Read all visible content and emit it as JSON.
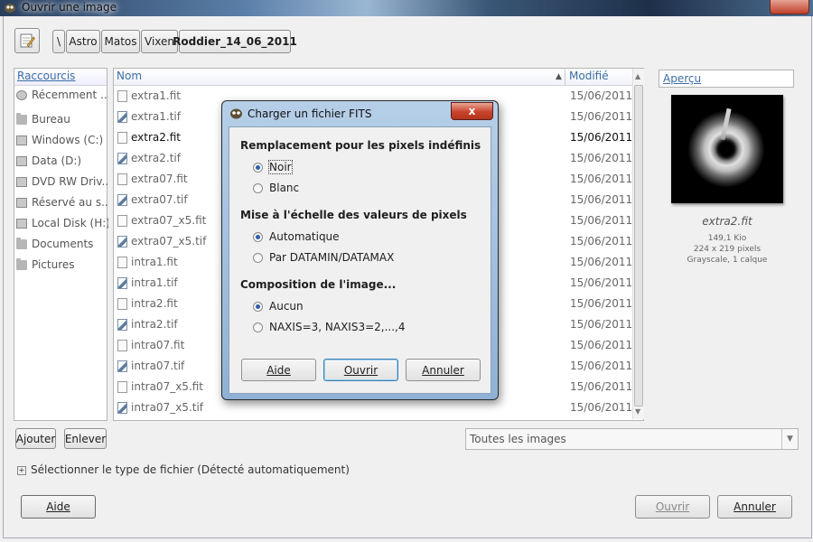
{
  "window": {
    "title": "Ouvrir une image"
  },
  "path_bar": {
    "edit_icon": "pencil-icon",
    "segments": [
      "\\",
      "Astro",
      "Matos",
      "Vixen",
      "Roddier_14_06_2011"
    ]
  },
  "places": {
    "header": "Raccourcis",
    "items": [
      "Récemment ...",
      "Bureau",
      "Windows (C:)",
      "Data (D:)",
      "DVD RW Driv...",
      "Réservé au s...",
      "Local Disk (H:)",
      "Documents",
      "Pictures"
    ]
  },
  "file_list": {
    "col_name": "Nom",
    "col_modified": "Modifié",
    "rows": [
      {
        "name": "extra1.fit",
        "date": "15/06/2011",
        "type": "fit"
      },
      {
        "name": "extra1.tif",
        "date": "15/06/2011",
        "type": "tif"
      },
      {
        "name": "extra2.fit",
        "date": "15/06/2011",
        "type": "fit",
        "selected": true
      },
      {
        "name": "extra2.tif",
        "date": "15/06/2011",
        "type": "tif"
      },
      {
        "name": "extra07.fit",
        "date": "15/06/2011",
        "type": "fit"
      },
      {
        "name": "extra07.tif",
        "date": "15/06/2011",
        "type": "tif"
      },
      {
        "name": "extra07_x5.fit",
        "date": "15/06/2011",
        "type": "fit"
      },
      {
        "name": "extra07_x5.tif",
        "date": "15/06/2011",
        "type": "tif"
      },
      {
        "name": "intra1.fit",
        "date": "15/06/2011",
        "type": "fit"
      },
      {
        "name": "intra1.tif",
        "date": "15/06/2011",
        "type": "tif"
      },
      {
        "name": "intra2.fit",
        "date": "15/06/2011",
        "type": "fit"
      },
      {
        "name": "intra2.tif",
        "date": "15/06/2011",
        "type": "tif"
      },
      {
        "name": "intra07.fit",
        "date": "15/06/2011",
        "type": "fit"
      },
      {
        "name": "intra07.tif",
        "date": "15/06/2011",
        "type": "tif"
      },
      {
        "name": "intra07_x5.fit",
        "date": "15/06/2011",
        "type": "fit"
      },
      {
        "name": "intra07_x5.tif",
        "date": "15/06/2011",
        "type": "tif"
      }
    ]
  },
  "preview": {
    "label": "Aperçu",
    "filename": "extra2.fit",
    "size": "149,1 Kio",
    "dimensions": "224 x 219 pixels",
    "mode": "Grayscale, 1 calque"
  },
  "buttons": {
    "add": "Ajouter",
    "remove": "Enlever",
    "help": "Aide",
    "open": "Ouvrir",
    "cancel": "Annuler"
  },
  "filter": {
    "selected": "Toutes les images"
  },
  "file_type_expander": "Sélectionner le type de fichier (Détecté automatiquement)",
  "dialog": {
    "title": "Charger un fichier FITS",
    "close": "x",
    "section1": "Remplacement pour les pixels indéfinis",
    "opt_noir": "Noir",
    "opt_blanc": "Blanc",
    "section2": "Mise à l'échelle des valeurs de pixels",
    "opt_auto": "Automatique",
    "opt_datamin": "Par DATAMIN/DATAMAX",
    "section3": "Composition de l'image...",
    "opt_aucun": "Aucun",
    "opt_naxis": "NAXIS=3, NAXIS3=2,...,4",
    "btn_help": "Aide",
    "btn_open": "Ouvrir",
    "btn_cancel": "Annuler"
  }
}
